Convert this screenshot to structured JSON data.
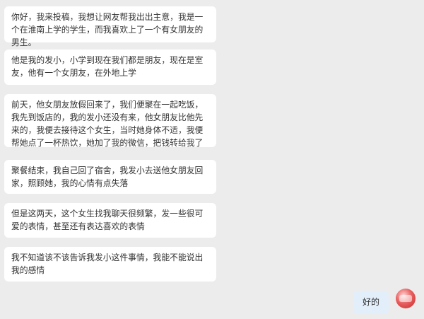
{
  "messages": [
    {
      "text": "你好，我来投稿，我想让网友帮我出出主意，我是一个在淮南上学的学生，而我喜欢上了一个有女朋友的男生。"
    },
    {
      "text": "他是我的发小，小学到现在我们都是朋友，现在是室友，他有一个女朋友，在外地上学"
    },
    {
      "text": "前天，他女朋友放假回来了，我们便聚在一起吃饭，我先到饭店的，我的发小还没有来，他女朋友比他先来的，我便去接待这个女生，当时她身体不适，我便帮她点了一杯热饮，她加了我的微信，把钱转给我了"
    },
    {
      "text": "聚餐结束，我自己回了宿舍，我发小去送他女朋友回家，照顾她，我的心情有点失落"
    },
    {
      "text": "但是这两天，这个女生找我聊天很频繁，发一些很可爱的表情，甚至还有表达喜欢的表情"
    },
    {
      "text": "我不知道该不该告诉我发小这件事情，我能不能说出我的感情"
    }
  ],
  "reply": {
    "text": "好的"
  },
  "avatar": {
    "icon": "user-avatar",
    "color": "#d32f2f"
  }
}
